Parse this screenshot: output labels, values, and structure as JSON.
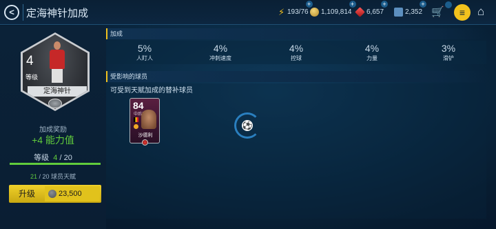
{
  "header": {
    "back_icon": "back-arrow-icon",
    "title": "定海神针加成",
    "currencies": {
      "energy": "193/76",
      "coins": "1,109,814",
      "gems": "6,657",
      "points": "2,352"
    },
    "icons": [
      "lightning-icon",
      "coin-icon",
      "gem-icon",
      "points-icon",
      "cart-icon",
      "menu-icon",
      "home-icon"
    ]
  },
  "skill": {
    "level": "4",
    "level_label": "等级",
    "name": "定海神针",
    "reward_label": "加成奖励",
    "reward_value": "+4 能力值",
    "level_text": "等级",
    "current_level": "4",
    "max_level": "/ 20",
    "level_progress": 1.0,
    "skill_points_current": "21",
    "skill_points_text": "/ 20 球员天赋",
    "upgrade_label": "升级",
    "upgrade_cost": "23,500"
  },
  "bonus": {
    "section_title": "加成",
    "items": [
      {
        "pct": "5%",
        "label": "人盯人"
      },
      {
        "pct": "4%",
        "label": "冲刺速度"
      },
      {
        "pct": "4%",
        "label": "控球"
      },
      {
        "pct": "4%",
        "label": "力量"
      },
      {
        "pct": "3%",
        "label": "滑铲"
      }
    ]
  },
  "affected": {
    "section_title": "受影响的球员",
    "description": "可受到天赋加成的替补球员",
    "players": [
      {
        "rating": "84",
        "position": "中后卫",
        "name": "沙德利"
      }
    ]
  },
  "colors": {
    "accent_yellow": "#f2c21d",
    "green": "#61cc3c",
    "background": "#0a2a44"
  }
}
